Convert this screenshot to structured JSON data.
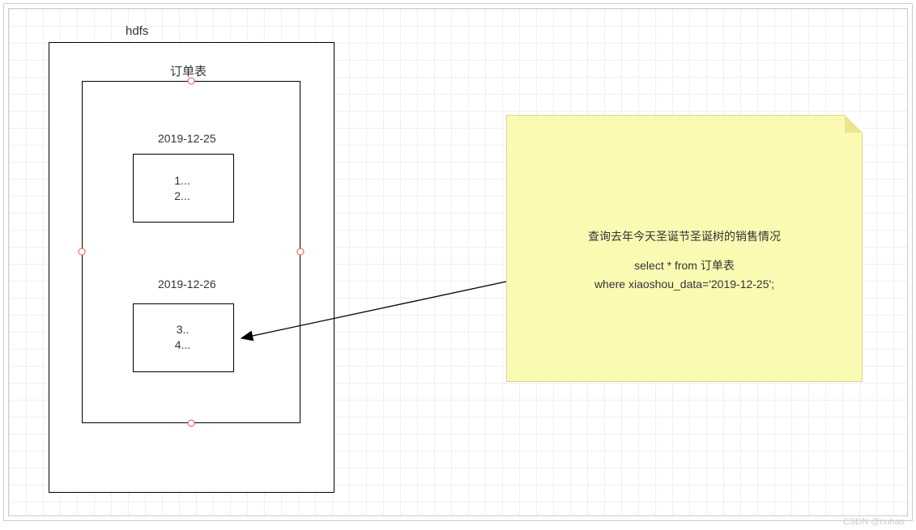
{
  "hdfs_label": "hdfs",
  "order_table_label": "订单表",
  "partition1": {
    "date": "2019-12-25",
    "line1": "1...",
    "line2": "2..."
  },
  "partition2": {
    "date": "2019-12-26",
    "line1": "3..",
    "line2": "4..."
  },
  "note": {
    "title": "查询去年今天圣诞节圣诞树的销售情况",
    "sql_line1": "select * from 订单表",
    "sql_line2": "where xiaoshou_data='2019-12-25';"
  },
  "watermark": "CSDN @nuhao"
}
